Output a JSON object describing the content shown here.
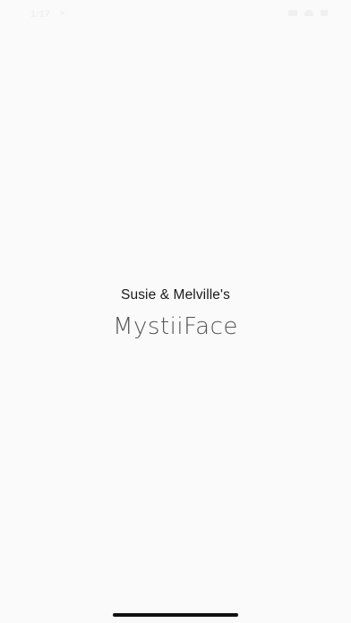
{
  "status_bar": {
    "time": "1:17",
    "location_icon": "location-arrow-icon",
    "signal_icon": "cellular-signal-icon",
    "wifi_icon": "wifi-icon",
    "battery_icon": "battery-icon"
  },
  "splash": {
    "subtitle": "Susie & Melville's",
    "title": "MystiiFace"
  },
  "colors": {
    "background": "#fafafa",
    "subtitle": "#1a1a1a",
    "title": "#555555",
    "home_indicator": "#111111"
  }
}
